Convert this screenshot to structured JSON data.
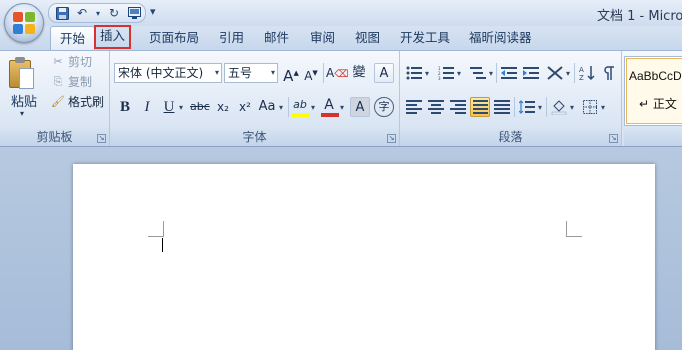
{
  "window": {
    "title": "文档 1 - Micro"
  },
  "quick_access": {
    "items": [
      "save-icon",
      "undo-icon",
      "redo-icon",
      "print-preview-icon"
    ],
    "more_glyph": "▾"
  },
  "tabs": [
    {
      "label": "开始",
      "active": true
    },
    {
      "label": "插入",
      "highlighted": true
    },
    {
      "label": "页面布局"
    },
    {
      "label": "引用"
    },
    {
      "label": "邮件"
    },
    {
      "label": "审阅"
    },
    {
      "label": "视图"
    },
    {
      "label": "开发工具"
    },
    {
      "label": "福昕阅读器"
    }
  ],
  "clipboard": {
    "paste": "粘贴",
    "cut": "剪切",
    "copy": "复制",
    "format_painter": "格式刷",
    "group_label": "剪贴板"
  },
  "font": {
    "font_name": "宋体 (中文正文)",
    "font_size": "五号",
    "grow": "A",
    "shrink": "A",
    "clear_format": "A",
    "phonetic": "變",
    "border_char": "A",
    "bold": "B",
    "italic": "I",
    "underline": "U",
    "strikethrough": "abc",
    "subscript": "x₂",
    "superscript": "x²",
    "change_case": "Aa",
    "highlight": "ab",
    "font_color": "A",
    "shading_char": "A",
    "enclose_char": "字",
    "group_label": "字体",
    "colors": {
      "highlight": "#ffff00",
      "font_color": "#d6322e"
    }
  },
  "paragraph": {
    "group_label": "段落",
    "selected": "justify"
  },
  "styles": {
    "sample": "AaBbCcD",
    "name": "↵ 正文"
  },
  "colors": {
    "highlight_border": "#d6322e",
    "ribbon_bg": "#dfe9f5",
    "workspace_bg": "#abc1dc"
  }
}
